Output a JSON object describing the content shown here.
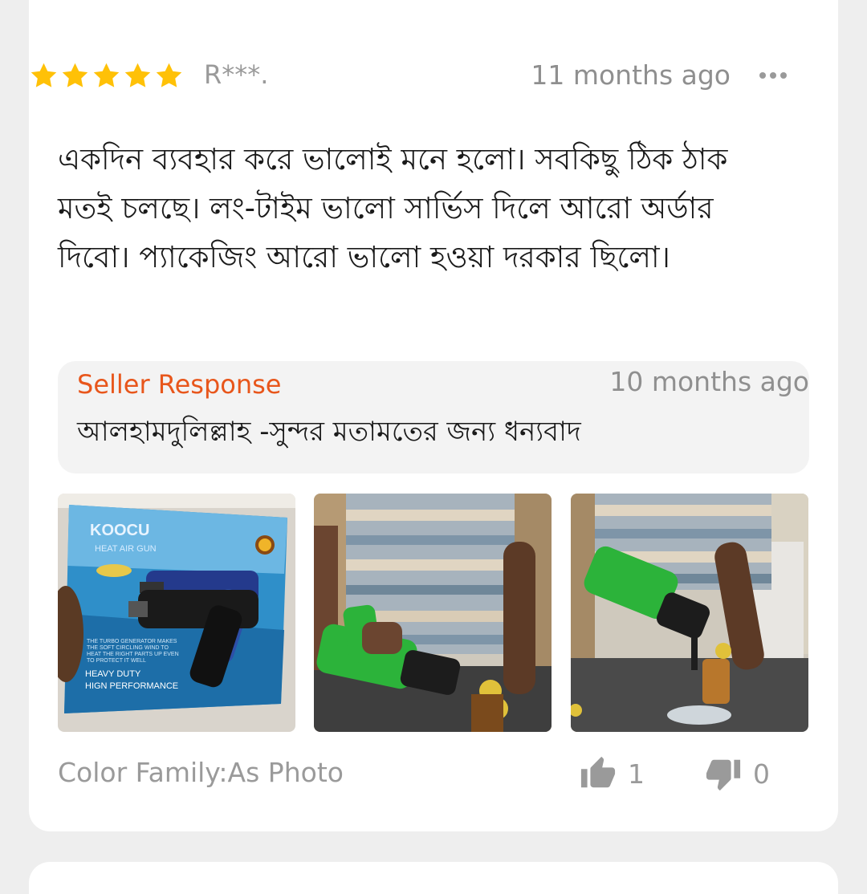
{
  "review": {
    "rating": 5,
    "rating_max": 5,
    "reviewer": "R***.",
    "time": "11 months ago",
    "text": "একদিন ব্যবহার করে ভালোই মনে হলো। সবকিছু ঠিক ঠাক মতই চলছে।  লং-টাইম ভালো সার্ভিস দিলে আরো অর্ডার দিবো। প্যাকেজিং আরো ভালো হওয়া দরকার ছিলো।"
  },
  "seller_response": {
    "title": "Seller Response",
    "time": "10 months ago",
    "text": "আলহামদুলিল্লাহ -সুন্দর মতামতের জন্য ধন্যবাদ"
  },
  "photos": [
    {
      "brand": "KOOCU",
      "product": "HEAT AIR GUN",
      "blurb": [
        "THE TURBO GENERATOR MAKES",
        "THE SOFT CIRCLING WIND TO",
        "HEAT THE RIGHT PARTS UP EVEN",
        "TO PROTECT IT WELL"
      ],
      "tagline": [
        "HEAVY DUTY",
        "HIGN PERFORMANCE"
      ]
    },
    {
      "brand": ""
    },
    {
      "brand": ""
    }
  ],
  "footer": {
    "color_family": "Color Family:As Photo",
    "likes": "1",
    "dislikes": "0"
  },
  "colors": {
    "star": "#ffc107",
    "seller_title": "#e8561b",
    "muted_text": "#9a9a9a"
  },
  "icons": {
    "more": "more-dots-icon",
    "like": "thumbs-up-icon",
    "dislike": "thumbs-down-icon"
  }
}
